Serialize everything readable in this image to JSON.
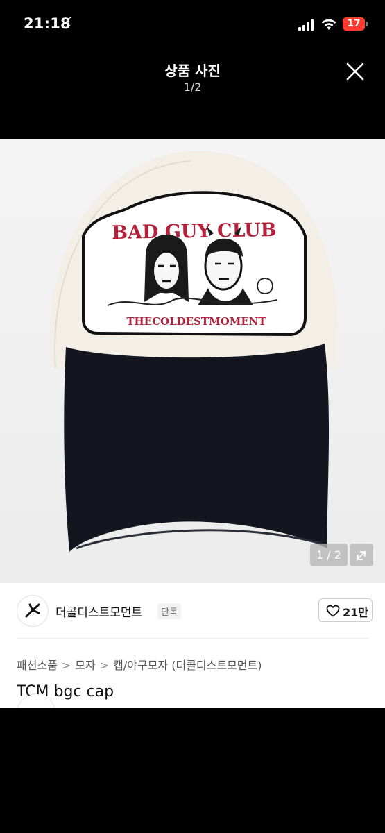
{
  "status_bar": {
    "time": "21:18",
    "battery": "17",
    "moon_icon": "moon-icon"
  },
  "header": {
    "title": "상품 사진",
    "count": "1/2"
  },
  "photo": {
    "counter": "1 / 2",
    "patch_title": "BAD GUY CLUB",
    "patch_subtitle": "THECOLDESTMOMENT"
  },
  "seller": {
    "name": "더콜디스트모먼트",
    "badge": "단독",
    "likes": "21만"
  },
  "breadcrumb": {
    "items": [
      "패션소품",
      "모자",
      "캡/야구모자 (더콜디스트모먼트)"
    ],
    "separator": ">"
  },
  "product": {
    "name": "TCM bgc cap"
  },
  "colors": {
    "accent": "#ff3b30",
    "patch_red": "#b5203a",
    "cap_crown": "#f3efe6",
    "cap_brim": "#13151f"
  }
}
